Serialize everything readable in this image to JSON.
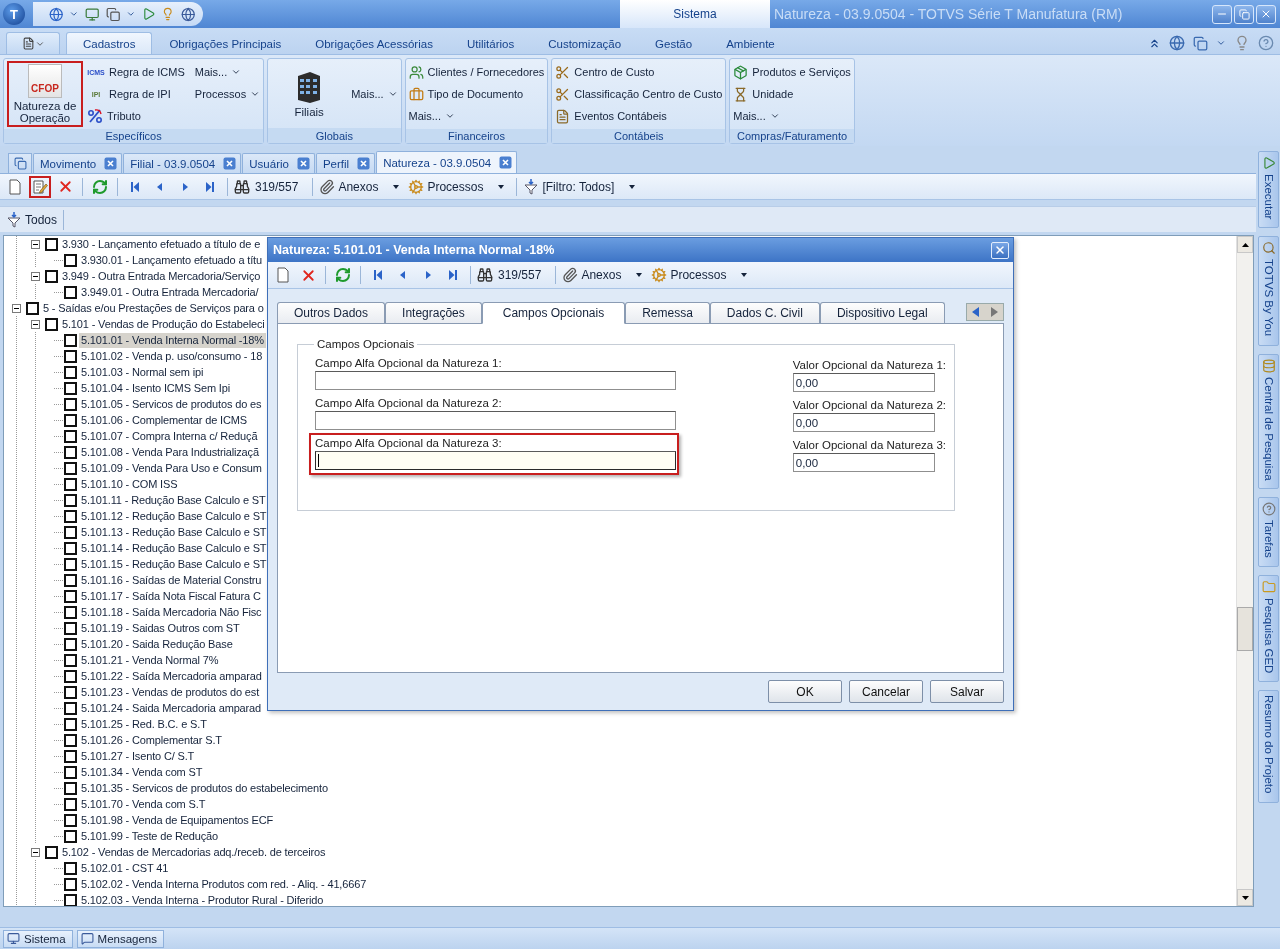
{
  "title_bar": {
    "logo": "T",
    "system_tab": "Sistema",
    "title": "Natureza - 03.9.0504 - TOTVS Série T Manufatura (RM)"
  },
  "ribbon": {
    "tabs": [
      {
        "label": "Cadastros",
        "selected": true
      },
      {
        "label": "Obrigações Principais",
        "selected": false
      },
      {
        "label": "Obrigações Acessórias",
        "selected": false
      },
      {
        "label": "Utilitários",
        "selected": false
      },
      {
        "label": "Customização",
        "selected": false
      },
      {
        "label": "Gestão",
        "selected": false
      },
      {
        "label": "Ambiente",
        "selected": false
      }
    ],
    "groups": [
      {
        "caption": "Específicos",
        "large": [
          {
            "label": "Natureza de Operação",
            "kind": "cfop",
            "icon_text": "CFOP",
            "highlighted": true
          }
        ],
        "items": [
          {
            "label": "Regra de ICMS",
            "kind": "icms",
            "icon_text": "ICMS"
          },
          {
            "label": "Regra de IPI",
            "kind": "ipi",
            "icon_text": "IPI"
          },
          {
            "label": "Tributo",
            "kind": "tax"
          },
          {
            "label": "Mais...",
            "kind": "menu"
          },
          {
            "label": "Processos",
            "kind": "menu"
          }
        ]
      },
      {
        "caption": "Globais",
        "large": [
          {
            "label": "Filiais",
            "kind": "building",
            "highlighted": false
          }
        ],
        "items": [
          {
            "label": "Mais...",
            "kind": "menu"
          }
        ]
      },
      {
        "caption": "Financeiros",
        "items": [
          {
            "label": "Clientes / Fornecedores",
            "kind": "people"
          },
          {
            "label": "Tipo de Documento",
            "kind": "briefcase"
          },
          {
            "label": "Mais...",
            "kind": "menu"
          }
        ]
      },
      {
        "caption": "Contábeis",
        "items": [
          {
            "label": "Centro de Custo",
            "kind": "cost"
          },
          {
            "label": "Classificação Centro de Custo",
            "kind": "cost"
          },
          {
            "label": "Eventos Contábeis",
            "kind": "event"
          }
        ]
      },
      {
        "caption": "Compras/Faturamento",
        "items": [
          {
            "label": "Produtos e Serviços",
            "kind": "product"
          },
          {
            "label": "Unidade",
            "kind": "unit"
          },
          {
            "label": "Mais...",
            "kind": "menu"
          }
        ]
      }
    ]
  },
  "documents": {
    "tabs": [
      {
        "label": "Movimento",
        "selected": false
      },
      {
        "label": "Filial - 03.9.0504",
        "selected": false
      },
      {
        "label": "Usuário",
        "selected": false
      },
      {
        "label": "Perfil",
        "selected": false
      },
      {
        "label": "Natureza - 03.9.0504",
        "selected": true
      }
    ]
  },
  "toolbar": {
    "groups": [
      [
        {
          "kind": "new",
          "highlighted": false
        },
        {
          "kind": "edit",
          "highlighted": true
        },
        {
          "kind": "delete",
          "highlighted": false
        }
      ],
      [
        {
          "kind": "refresh",
          "highlighted": false
        }
      ],
      [
        {
          "kind": "first",
          "highlighted": false
        },
        {
          "kind": "prev",
          "highlighted": false
        },
        {
          "kind": "next",
          "highlighted": false
        },
        {
          "kind": "last",
          "highlighted": false
        }
      ]
    ],
    "counter": "319/557",
    "menus": [
      {
        "label": "Anexos",
        "kind": "attach"
      },
      {
        "label": "Processos",
        "kind": "process"
      },
      {
        "label": "[Filtro: Todos]",
        "kind": "filter"
      }
    ]
  },
  "filter": {
    "label": "Todos"
  },
  "tree": {
    "items": [
      {
        "children": [
          {
            "label": "3.930 - Lançamento efetuado a título de e",
            "checked": false,
            "selected": false,
            "expanded": true,
            "children": [
              {
                "label": "3.930.01 - Lançamento efetuado a títu",
                "checked": false,
                "selected": false
              }
            ]
          },
          {
            "label": "3.949 - Outra Entrada Mercadoria/Serviço",
            "checked": false,
            "selected": false,
            "expanded": true,
            "children": [
              {
                "label": "3.949.01 - Outra Entrada Mercadoria/",
                "checked": false,
                "selected": false
              }
            ]
          }
        ]
      },
      {
        "label": "5 - Saídas e/ou Prestações de Serviços para o",
        "checked": false,
        "selected": false,
        "expanded": true,
        "children": [
          {
            "label": "5.101 - Vendas de Produção do Estabeleci",
            "checked": false,
            "selected": false,
            "expanded": true,
            "children": [
              {
                "label": "5.101.01 - Venda Interna Normal -18%",
                "checked": false,
                "selected": true
              },
              {
                "label": "5.101.02 - Venda p. uso/consumo - 18",
                "checked": false,
                "selected": false
              },
              {
                "label": "5.101.03 - Normal sem ipi",
                "checked": false,
                "selected": false
              },
              {
                "label": "5.101.04 - Isento ICMS Sem Ipi",
                "checked": false,
                "selected": false
              },
              {
                "label": "5.101.05 - Servicos de  produtos do es",
                "checked": false,
                "selected": false
              },
              {
                "label": "5.101.06 - Complementar de ICMS",
                "checked": false,
                "selected": false
              },
              {
                "label": "5.101.07 - Compra Interna c/ Reduçã",
                "checked": false,
                "selected": false
              },
              {
                "label": "5.101.08 - Venda Para Industrializaçã",
                "checked": false,
                "selected": false
              },
              {
                "label": "5.101.09 - Venda Para Uso e Consum",
                "checked": false,
                "selected": false
              },
              {
                "label": "5.101.10 - COM ISS",
                "checked": false,
                "selected": false
              },
              {
                "label": "5.101.11 - Redução Base Calculo e ST",
                "checked": false,
                "selected": false
              },
              {
                "label": "5.101.12 - Redução  Base Calculo e ST",
                "checked": false,
                "selected": false
              },
              {
                "label": "5.101.13 - Redução Base Calculo e ST",
                "checked": false,
                "selected": false
              },
              {
                "label": "5.101.14 - Redução Base Calculo e ST",
                "checked": false,
                "selected": false
              },
              {
                "label": "5.101.15 - Redução Base Calculo e ST",
                "checked": false,
                "selected": false
              },
              {
                "label": "5.101.16 - Saídas de Material Constru",
                "checked": false,
                "selected": false
              },
              {
                "label": "5.101.17 - Saída Nota Fiscal Fatura C",
                "checked": false,
                "selected": false
              },
              {
                "label": "5.101.18 - Saída Mercadoria Não Fisc",
                "checked": false,
                "selected": false
              },
              {
                "label": "5.101.19 - Saidas Outros com ST",
                "checked": false,
                "selected": false
              },
              {
                "label": "5.101.20 - Saida Redução Base",
                "checked": false,
                "selected": false
              },
              {
                "label": "5.101.21 - Venda Normal 7%",
                "checked": false,
                "selected": false
              },
              {
                "label": "5.101.22 - Saída Mercadoria amparad",
                "checked": false,
                "selected": false
              },
              {
                "label": "5.101.23 - Vendas de produtos do est",
                "checked": false,
                "selected": false
              },
              {
                "label": "5.101.24 - Saida Mercadoria amparad",
                "checked": false,
                "selected": false
              },
              {
                "label": "5.101.25 - Red. B.C. e S.T",
                "checked": false,
                "selected": false
              },
              {
                "label": "5.101.26 - Complementar S.T",
                "checked": false,
                "selected": false
              },
              {
                "label": "5.101.27 - Isento C/ S.T",
                "checked": false,
                "selected": false
              },
              {
                "label": "5.101.34 - Venda com ST",
                "checked": false,
                "selected": false
              },
              {
                "label": "5.101.35 - Servicos de  produtos do estabelecimento",
                "checked": false,
                "selected": false
              },
              {
                "label": "5.101.70 - Venda com S.T",
                "checked": false,
                "selected": false
              },
              {
                "label": "5.101.98 - Venda de Equipamentos ECF",
                "checked": false,
                "selected": false
              },
              {
                "label": "5.101.99 - Teste de Redução",
                "checked": false,
                "selected": false
              }
            ]
          },
          {
            "label": "5.102 - Vendas de Mercadorias adq./receb. de terceiros",
            "checked": false,
            "selected": false,
            "expanded": true,
            "children": [
              {
                "label": "5.102.01 - CST 41",
                "checked": false,
                "selected": false
              },
              {
                "label": "5.102.02 - Venda Interna Produtos com  red. - Aliq. - 41,6667",
                "checked": false,
                "selected": false
              },
              {
                "label": "5.102.03 - Venda Interna - Produtor Rural - Diferido",
                "checked": false,
                "selected": false
              }
            ]
          }
        ]
      }
    ]
  },
  "side_panel": {
    "tabs": [
      {
        "label": "Executar",
        "kind": "run"
      },
      {
        "label": "TOTVS By You",
        "kind": "search"
      },
      {
        "label": "Central de Pesquisa",
        "kind": "database"
      },
      {
        "label": "Tarefas",
        "kind": "task"
      },
      {
        "label": "Pesquisa GED",
        "kind": "folder"
      },
      {
        "label": "Resumo do Projeto"
      }
    ]
  },
  "status_bar": {
    "buttons": [
      {
        "label": "Sistema",
        "kind": "system"
      },
      {
        "label": "Mensagens",
        "kind": "messages"
      }
    ]
  },
  "dialog": {
    "title": "Natureza: 5.101.01 - Venda Interna Normal -18%",
    "toolbar": {
      "groups": [
        [
          {
            "kind": "new",
            "highlighted": false
          },
          {
            "kind": "delete",
            "highlighted": false
          }
        ],
        [
          {
            "kind": "refresh",
            "highlighted": false
          }
        ],
        [
          {
            "kind": "first",
            "highlighted": false
          },
          {
            "kind": "prev",
            "highlighted": false
          },
          {
            "kind": "next",
            "highlighted": false
          },
          {
            "kind": "last",
            "highlighted": false
          }
        ]
      ],
      "counter": "319/557",
      "menus": [
        {
          "label": "Anexos",
          "kind": "attach"
        },
        {
          "label": "Processos",
          "kind": "process"
        }
      ]
    },
    "tabs": [
      {
        "label": "Outros Dados",
        "selected": false
      },
      {
        "label": "Integrações",
        "selected": false
      },
      {
        "label": "Campos Opcionais",
        "selected": true
      },
      {
        "label": "Remessa",
        "selected": false
      },
      {
        "label": "Dados C. Civil",
        "selected": false
      },
      {
        "label": "Dispositivo Legal",
        "selected": false
      }
    ],
    "group": {
      "title": "Campos Opcionais",
      "rows": [
        {
          "text_label": "Campo Alfa Opcional da Natureza 1:",
          "focused": false,
          "highlighted": false,
          "value_label": "Valor Opcional da Natureza 1:",
          "value": "0,00"
        },
        {
          "text_label": "Campo Alfa Opcional da Natureza 2:",
          "focused": false,
          "highlighted": false,
          "value_label": "Valor Opcional da Natureza 2:",
          "value": "0,00"
        },
        {
          "text_label": "Campo Alfa Opcional da Natureza 3:",
          "focused": true,
          "highlighted": true,
          "value_label": "Valor Opcional da Natureza 3:",
          "value": "0,00"
        }
      ]
    },
    "buttons": [
      "OK",
      "Cancelar",
      "Salvar"
    ]
  }
}
